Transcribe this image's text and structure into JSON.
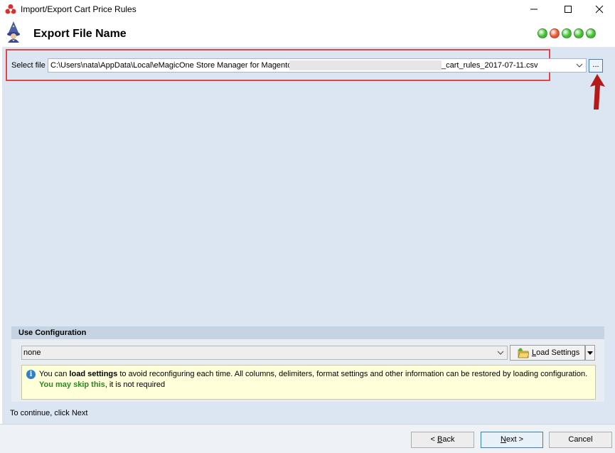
{
  "window": {
    "title": "Import/Export Cart Price Rules",
    "minimize_glyph": "—",
    "maximize_glyph": "☐",
    "close_glyph": "✕"
  },
  "header": {
    "title": "Export File Name",
    "steps": [
      {
        "status": "done",
        "color": "#3fbf2f"
      },
      {
        "status": "current",
        "color": "#e8542a"
      },
      {
        "status": "pending",
        "color": "#3fbf2f"
      },
      {
        "status": "pending",
        "color": "#3fbf2f"
      },
      {
        "status": "pending",
        "color": "#3fbf2f"
      }
    ]
  },
  "file": {
    "label": "Select file",
    "path_prefix": "C:\\Users\\nata\\AppData\\Local\\eMagicOne Store Manager for Magento\\",
    "path_suffix": "_cart_rules_2017-07-11.csv",
    "browse_label": "..."
  },
  "config": {
    "title": "Use Configuration",
    "selected": "none",
    "load_button": "Load Settings",
    "info_prefix": "You can ",
    "info_bold": "load settings",
    "info_rest": " to avoid reconfiguring each time. All columns, delimiters, format settings and other information can be restored by loading configuration.",
    "info_skip": "You may skip this",
    "info_tail": ", it is not required"
  },
  "continue_text": "To continue, click Next",
  "buttons": {
    "back": "Back",
    "next": "Next >",
    "cancel": "Cancel"
  },
  "colors": {
    "panel": "#dce6f2",
    "highlight": "#e04848",
    "annotation_arrow": "#b51a1a"
  }
}
